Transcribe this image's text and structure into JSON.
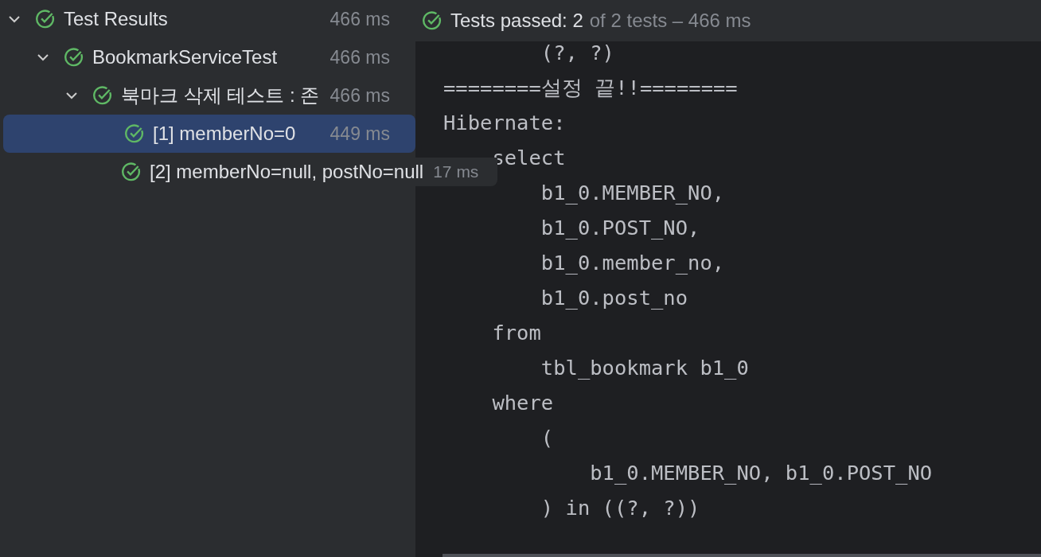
{
  "tree": [
    {
      "label": "Test Results",
      "time": "466 ms",
      "passed": true,
      "expanded": true,
      "selected": false,
      "children": [
        {
          "label": "BookmarkServiceTest",
          "time": "466 ms",
          "passed": true,
          "expanded": true,
          "selected": false,
          "children": [
            {
              "label": "북마크 삭제 테스트 : 존",
              "time": "466 ms",
              "passed": true,
              "expanded": true,
              "selected": false,
              "children": [
                {
                  "label": "[1] memberNo=0",
                  "time": "449 ms",
                  "passed": true,
                  "selected": true,
                  "hovered": false
                },
                {
                  "label": "[2] memberNo=null, postNo=null",
                  "time": "17 ms",
                  "passed": true,
                  "selected": false,
                  "hovered": true
                }
              ]
            }
          ]
        }
      ]
    }
  ],
  "status": {
    "passed": true,
    "summary": "Tests passed: 2",
    "detail": "of 2 tests – 466 ms"
  },
  "console": [
    "        (?, ?)",
    "========설정 끝!!========",
    "Hibernate:",
    "    select",
    "        b1_0.MEMBER_NO,",
    "        b1_0.POST_NO,",
    "        b1_0.member_no,",
    "        b1_0.post_no",
    "    from",
    "        tbl_bookmark b1_0",
    "    where",
    "        (",
    "            b1_0.MEMBER_NO, b1_0.POST_NO",
    "        ) in ((?, ?))"
  ]
}
